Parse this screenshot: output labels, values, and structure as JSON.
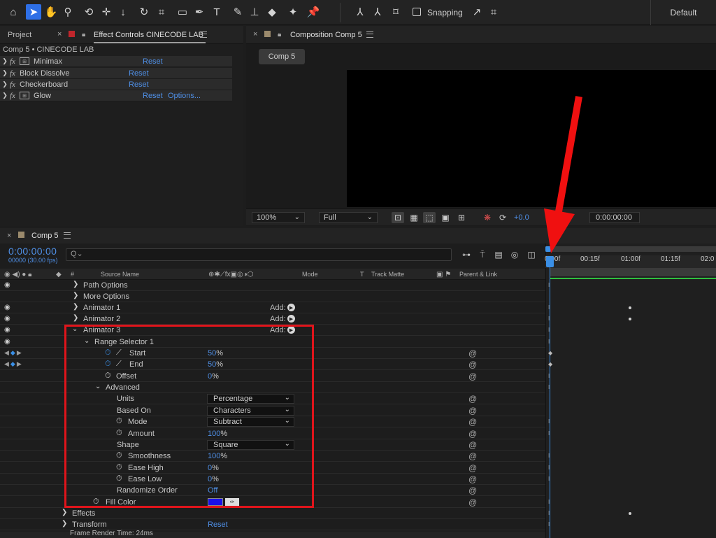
{
  "toolbar": {
    "snapping_label": "Snapping",
    "workspace": "Default"
  },
  "project_panel": {
    "tab_project": "Project",
    "tab_effect_controls": "Effect Controls CINECODE LAB",
    "breadcrumb": "Comp 5 • CINECODE LAB",
    "effects": [
      {
        "name": "Minimax",
        "reset": "Reset",
        "options": ""
      },
      {
        "name": "Block Dissolve",
        "reset": "Reset",
        "options": ""
      },
      {
        "name": "Checkerboard",
        "reset": "Reset",
        "options": ""
      },
      {
        "name": "Glow",
        "reset": "Reset",
        "options": "Options..."
      }
    ]
  },
  "viewer": {
    "tab_title": "Composition Comp 5",
    "comp_chip": "Comp 5",
    "zoom": "100%",
    "resolution": "Full",
    "exposure": "+0.0",
    "timecode": "0:00:00:00"
  },
  "timeline": {
    "tab_title": "Comp 5",
    "current_time": "0:00:00:00",
    "frame_info": "00000 (30.00 fps)",
    "search_placeholder": "Q⌄",
    "headers": {
      "hash": "#",
      "source_name": "Source Name",
      "mode": "Mode",
      "t": "T",
      "track_matte": "Track Matte",
      "parent_link": "Parent & Link"
    },
    "ruler_ticks": [
      "0:00f",
      "00:15f",
      "01:00f",
      "01:15f",
      "02:0"
    ],
    "rows": {
      "path_options": "Path Options",
      "more_options": "More Options",
      "animator1": "Animator 1",
      "animator2": "Animator 2",
      "animator3": "Animator 3",
      "add_label": "Add:",
      "range_selector": "Range Selector 1",
      "start": {
        "label": "Start",
        "value": "50",
        "unit": "%"
      },
      "end": {
        "label": "End",
        "value": "50",
        "unit": "%"
      },
      "offset": {
        "label": "Offset",
        "value": "0",
        "unit": "%"
      },
      "advanced": "Advanced",
      "units": {
        "label": "Units",
        "value": "Percentage"
      },
      "based_on": {
        "label": "Based On",
        "value": "Characters"
      },
      "mode": {
        "label": "Mode",
        "value": "Subtract"
      },
      "amount": {
        "label": "Amount",
        "value": "100",
        "unit": "%"
      },
      "shape": {
        "label": "Shape",
        "value": "Square"
      },
      "smoothness": {
        "label": "Smoothness",
        "value": "100",
        "unit": "%"
      },
      "ease_high": {
        "label": "Ease High",
        "value": "0",
        "unit": "%"
      },
      "ease_low": {
        "label": "Ease Low",
        "value": "0",
        "unit": "%"
      },
      "randomize": {
        "label": "Randomize Order",
        "value": "Off"
      },
      "fill_color": {
        "label": "Fill Color"
      },
      "effects": "Effects",
      "transform": {
        "label": "Transform",
        "reset": "Reset"
      }
    },
    "status": "Frame Render Time: 24ms"
  },
  "colors": {
    "accent_blue": "#4f8fe6",
    "fill_color": "#1a10e8",
    "highlight_red": "#e0141b",
    "work_area_green": "#2fbf3f"
  }
}
